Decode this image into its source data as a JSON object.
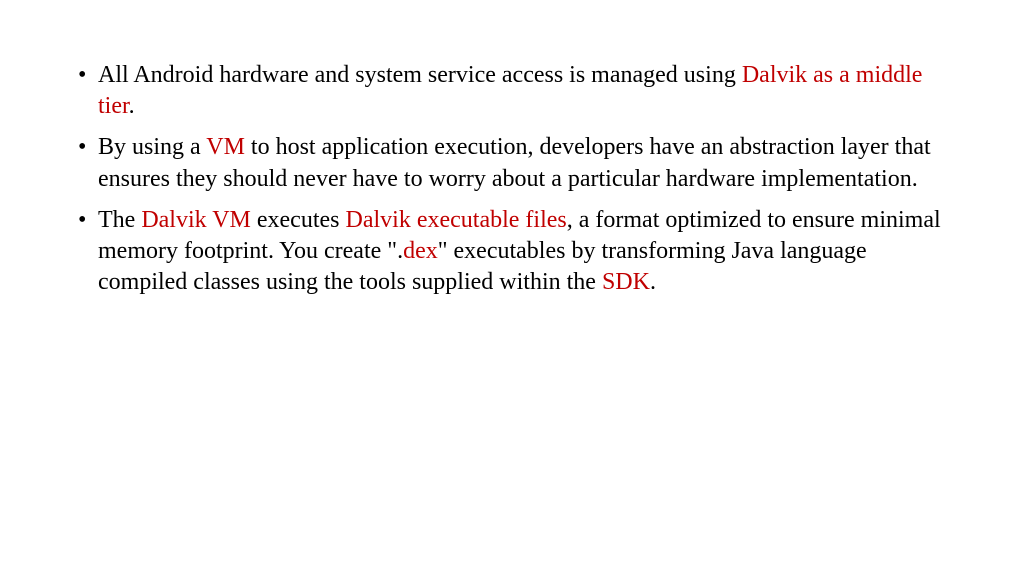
{
  "bullets": [
    {
      "segments": [
        {
          "text": "All Android hardware and system service access is managed using ",
          "red": false
        },
        {
          "text": "Dalvik as a middle tier",
          "red": true
        },
        {
          "text": ".",
          "red": false
        }
      ]
    },
    {
      "segments": [
        {
          "text": "By using a ",
          "red": false
        },
        {
          "text": "VM",
          "red": true
        },
        {
          "text": " to host application execution, developers have an abstraction layer that ensures they should never have to worry about a particular hardware implementation.",
          "red": false
        }
      ]
    },
    {
      "segments": [
        {
          "text": "The ",
          "red": false
        },
        {
          "text": "Dalvik VM ",
          "red": true
        },
        {
          "text": "executes ",
          "red": false
        },
        {
          "text": "Dalvik executable files",
          "red": true
        },
        {
          "text": ", a format optimized to ensure minimal memory footprint. You create \".",
          "red": false
        },
        {
          "text": "dex",
          "red": true
        },
        {
          "text": "\" executables by transforming Java language compiled classes using the tools supplied within the ",
          "red": false
        },
        {
          "text": "SDK",
          "red": true
        },
        {
          "text": ".",
          "red": false
        }
      ]
    }
  ]
}
